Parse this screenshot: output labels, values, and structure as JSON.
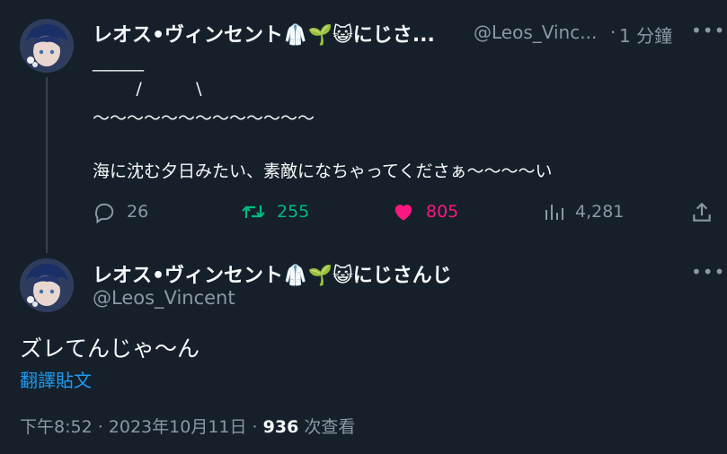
{
  "parent_tweet": {
    "display_name": "レオス•ヴィンセント🥼🌱😺にじさ...",
    "handle": "@Leos_Vinc...",
    "separator": "·",
    "time": "1 分鐘",
    "more": "•••",
    "body_lines": [
      "______",
      "        /          \\",
      "〜〜〜〜〜〜〜〜〜〜〜〜〜",
      "",
      "海に沈む夕日みたい、素敵になちゃってくださぁ〜〜〜〜い"
    ],
    "actions": {
      "reply_count": "26",
      "retweet_count": "255",
      "like_count": "805",
      "view_count": "4,281"
    }
  },
  "main_tweet": {
    "display_name": "レオス•ヴィンセント🥼🌱😺にじさんじ",
    "handle": "@Leos_Vincent",
    "more": "•••",
    "text": "ズレてんじゃ〜ん",
    "translate_label": "翻譯貼文",
    "timestamp": "下午8:52 · 2023年10月11日 ·",
    "views_value": "936",
    "views_label": "次查看"
  },
  "colors": {
    "background": "#15202b",
    "text": "#f7f9f9",
    "muted": "#8b98a5",
    "retweet": "#00ba7c",
    "like": "#f91880",
    "link": "#1d9bf0"
  }
}
